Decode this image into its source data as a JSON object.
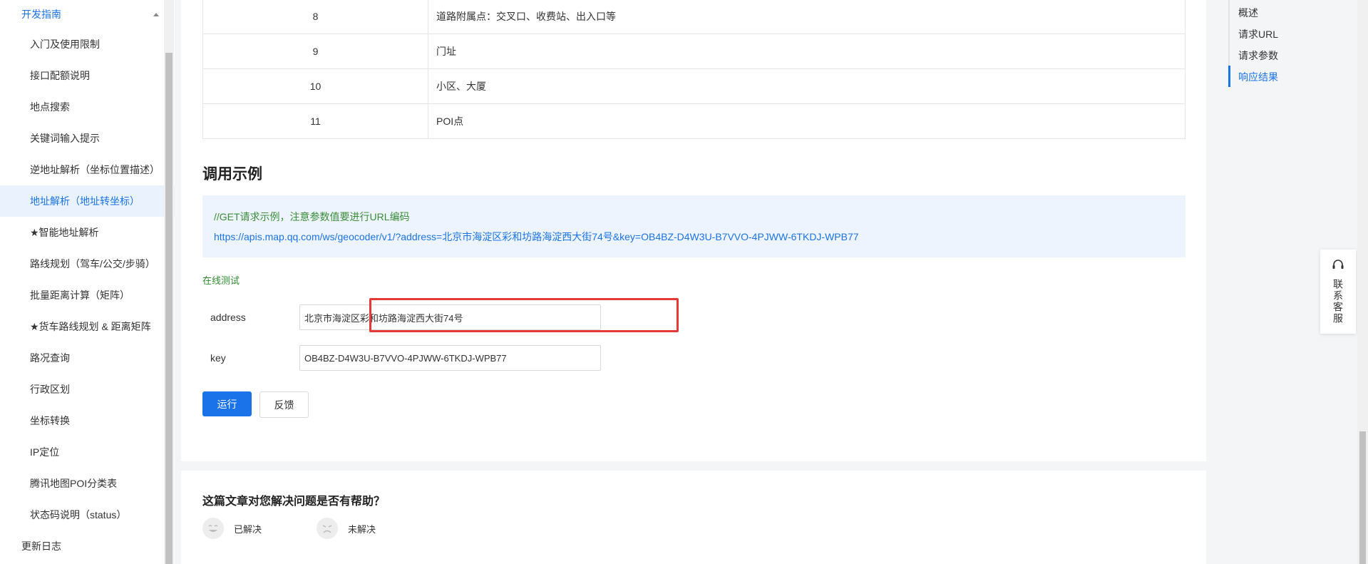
{
  "sidebar": {
    "section_label": "开发指南",
    "items": [
      {
        "label": "入门及使用限制"
      },
      {
        "label": "接口配额说明"
      },
      {
        "label": "地点搜索"
      },
      {
        "label": "关键词输入提示"
      },
      {
        "label": "逆地址解析（坐标位置描述）"
      },
      {
        "label": "地址解析（地址转坐标）",
        "active": true
      },
      {
        "label": "★智能地址解析"
      },
      {
        "label": "路线规划（驾车/公交/步骑）"
      },
      {
        "label": "批量距离计算（矩阵）"
      },
      {
        "label": "★货车路线规划 & 距离矩阵"
      },
      {
        "label": "路况查询"
      },
      {
        "label": "行政区划"
      },
      {
        "label": "坐标转换"
      },
      {
        "label": "IP定位"
      },
      {
        "label": "腾讯地图POI分类表"
      },
      {
        "label": "状态码说明（status）"
      }
    ],
    "footer_label": "更新日志"
  },
  "table": {
    "rows": [
      {
        "num": "8",
        "desc": "道路附属点：交叉口、收费站、出入口等"
      },
      {
        "num": "9",
        "desc": "门址"
      },
      {
        "num": "10",
        "desc": "小区、大厦"
      },
      {
        "num": "11",
        "desc": "POI点"
      }
    ]
  },
  "example": {
    "title": "调用示例",
    "comment": "//GET请求示例，注意参数值要进行URL编码",
    "url": "https://apis.map.qq.com/ws/geocoder/v1/?address=北京市海淀区彩和坊路海淀西大街74号&key=OB4BZ-D4W3U-B7VVO-4PJWW-6TKDJ-WPB77"
  },
  "online_test": {
    "label": "在线测试",
    "address_label": "address",
    "address_value": "北京市海淀区彩和坊路海淀西大街74号",
    "key_label": "key",
    "key_value": "OB4BZ-D4W3U-B7VVO-4PJWW-6TKDJ-WPB77",
    "run_label": "运行",
    "feedback_label": "反馈"
  },
  "help": {
    "title": "这篇文章对您解决问题是否有帮助？",
    "solved_label": "已解决",
    "unsolved_label": "未解决"
  },
  "toc": {
    "items": [
      {
        "label": "概述"
      },
      {
        "label": "请求URL"
      },
      {
        "label": "请求参数"
      },
      {
        "label": "响应结果",
        "active": true
      }
    ]
  },
  "contact": {
    "label": "联系客服",
    "icon": "headset-icon"
  },
  "colors": {
    "accent": "#1a73e8",
    "highlight": "#e53935",
    "code_comment": "#3a8c3a"
  }
}
